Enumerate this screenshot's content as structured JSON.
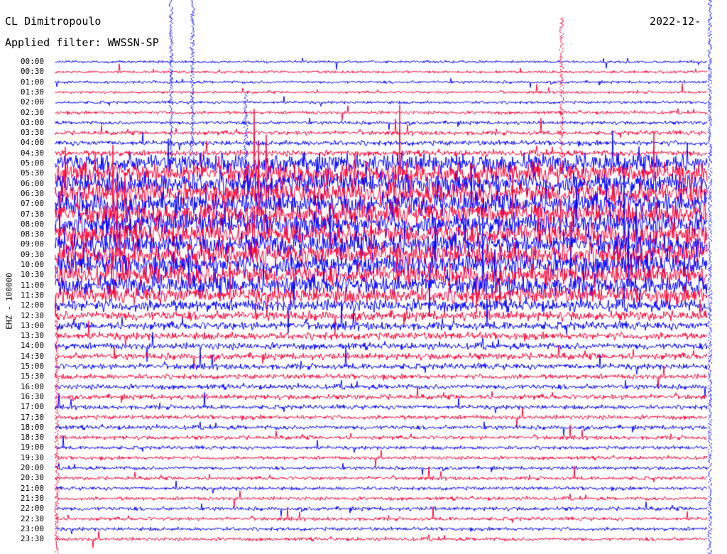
{
  "header": {
    "station": "CL Dimitropoulo",
    "filter": "Applied filter: WWSSN-SP",
    "date": "2022-12-"
  },
  "colors": {
    "trace_a": "#0000ff",
    "trace_b": "#ff0033",
    "background": "#ffffff",
    "text": "#000000"
  },
  "chart_data": {
    "type": "line",
    "title": "CL Dimitropoulo",
    "subtitle": "Applied filter: WWSSN-SP",
    "ylabel": "EHZ - 100000",
    "xlabel": "",
    "y_tick_labels": [
      "00:00",
      "00:30",
      "01:00",
      "01:30",
      "02:00",
      "02:30",
      "03:00",
      "03:30",
      "04:00",
      "04:30",
      "05:00",
      "05:30",
      "06:00",
      "06:30",
      "07:00",
      "07:30",
      "08:00",
      "08:30",
      "09:00",
      "09:30",
      "10:00",
      "10:30",
      "11:00",
      "11:30",
      "12:00",
      "12:30",
      "13:00",
      "13:30",
      "14:00",
      "14:30",
      "15:00",
      "15:30",
      "16:00",
      "16:30",
      "17:00",
      "17:30",
      "18:00",
      "18:30",
      "19:00",
      "19:30",
      "20:00",
      "20:30",
      "21:00",
      "21:30",
      "22:00",
      "22:30",
      "23:00",
      "23:30"
    ],
    "series": [
      {
        "color": "#0000ff",
        "traces": "even rows (00:00, 01:00, ...)"
      },
      {
        "color": "#ff0033",
        "traces": "odd rows (00:30, 01:30, ...)"
      }
    ],
    "relative_amplitude": [
      0.35,
      0.35,
      0.4,
      0.35,
      0.4,
      0.45,
      0.5,
      0.6,
      0.7,
      0.8,
      2.6,
      2.8,
      2.9,
      3.0,
      3.0,
      3.0,
      3.0,
      3.0,
      3.0,
      3.0,
      3.0,
      2.8,
      2.6,
      2.2,
      1.6,
      1.3,
      1.1,
      1.0,
      0.9,
      0.9,
      0.8,
      0.7,
      0.7,
      0.7,
      0.6,
      0.6,
      0.6,
      0.55,
      0.5,
      0.5,
      0.5,
      0.5,
      0.5,
      0.5,
      0.55,
      0.5,
      0.5,
      0.5
    ],
    "grid": false,
    "legend": "none"
  }
}
